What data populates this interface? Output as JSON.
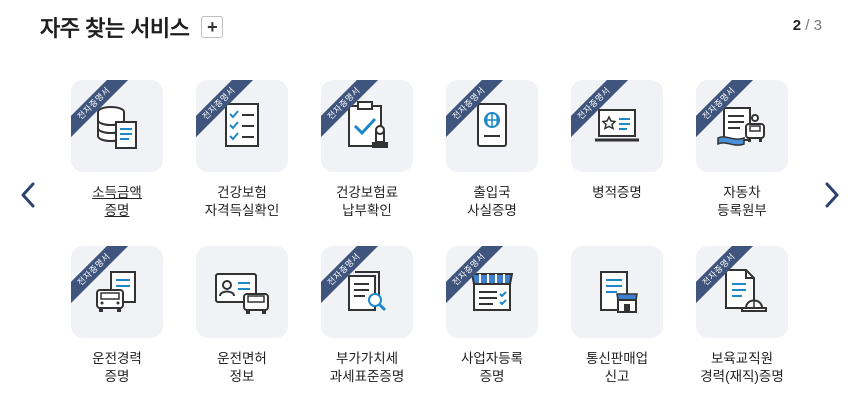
{
  "header": {
    "title": "자주 찾는 서비스",
    "add_label": "+"
  },
  "pager": {
    "current": "2",
    "separator": " / ",
    "total": "3"
  },
  "badge_text": "전자증명서",
  "services": [
    {
      "line1": "소득금액",
      "line2": "증명",
      "badge": true,
      "icon": "database-document-icon",
      "link": true
    },
    {
      "line1": "건강보험",
      "line2": "자격득실확인",
      "badge": true,
      "icon": "checklist-icon",
      "link": false
    },
    {
      "line1": "건강보험료",
      "line2": "납부확인",
      "badge": true,
      "icon": "clipboard-stamp-icon",
      "link": false
    },
    {
      "line1": "출입국",
      "line2": "사실증명",
      "badge": true,
      "icon": "passport-icon",
      "link": false
    },
    {
      "line1": "병적증명",
      "line2": "",
      "badge": true,
      "icon": "laptop-star-icon",
      "link": false
    },
    {
      "line1": "자동차",
      "line2": "등록원부",
      "badge": true,
      "icon": "car-register-icon",
      "link": false
    },
    {
      "line1": "운전경력",
      "line2": "증명",
      "badge": true,
      "icon": "car-document-icon",
      "link": false
    },
    {
      "line1": "운전면허",
      "line2": "정보",
      "badge": false,
      "icon": "license-card-icon",
      "link": false
    },
    {
      "line1": "부가가치세",
      "line2": "과세표준증명",
      "badge": true,
      "icon": "document-search-icon",
      "link": false
    },
    {
      "line1": "사업자등록",
      "line2": "증명",
      "badge": true,
      "icon": "store-icon",
      "link": false
    },
    {
      "line1": "통신판매업",
      "line2": "신고",
      "badge": false,
      "icon": "document-store-icon",
      "link": false
    },
    {
      "line1": "보육교직원",
      "line2": "경력(재직)증명",
      "badge": true,
      "icon": "document-helmet-icon",
      "link": false
    }
  ],
  "colors": {
    "navy": "#3f557d",
    "accent": "#1e88c8",
    "tile": "#f1f2f5"
  }
}
